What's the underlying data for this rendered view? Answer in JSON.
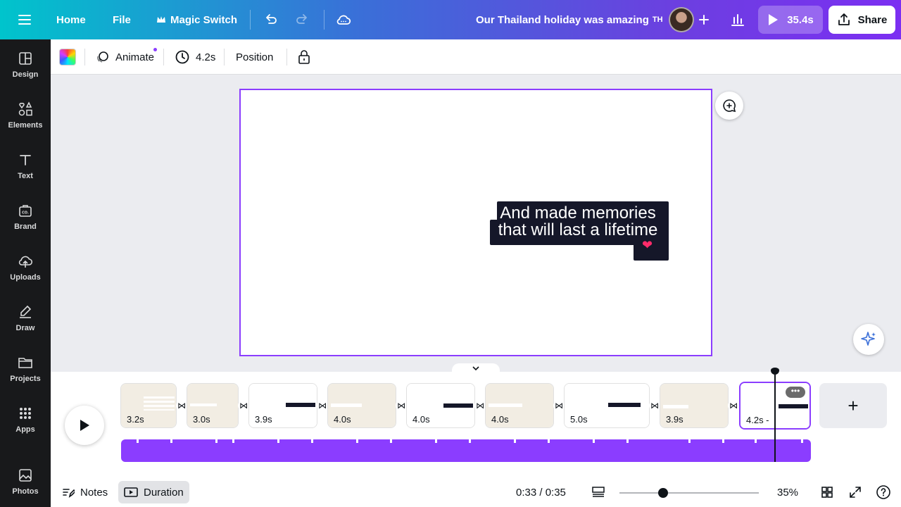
{
  "topbar": {
    "home_label": "Home",
    "file_label": "File",
    "magic_label": "Magic Switch",
    "doc_title": "Our Thailand holiday was amazing",
    "doc_title_flag": "TH",
    "play_label": "35.4s",
    "share_label": "Share"
  },
  "sidebar": {
    "items": [
      {
        "label": "Design",
        "icon": "design-icon"
      },
      {
        "label": "Elements",
        "icon": "elements-icon"
      },
      {
        "label": "Text",
        "icon": "text-icon"
      },
      {
        "label": "Brand",
        "icon": "brand-icon"
      },
      {
        "label": "Uploads",
        "icon": "uploads-icon"
      },
      {
        "label": "Draw",
        "icon": "draw-icon"
      },
      {
        "label": "Projects",
        "icon": "projects-icon"
      },
      {
        "label": "Apps",
        "icon": "apps-icon"
      },
      {
        "label": "Photos",
        "icon": "photos-icon"
      }
    ]
  },
  "context_toolbar": {
    "animate_label": "Animate",
    "duration_label": "4.2s",
    "position_label": "Position"
  },
  "canvas": {
    "caption_line1": "And made memories",
    "caption_line2": "that will last a lifetime",
    "heart_emoji": "❤"
  },
  "timeline": {
    "clips": [
      {
        "duration": "3.2s",
        "bg": "#f2ede3"
      },
      {
        "duration": "3.0s",
        "bg": "#f2ede3"
      },
      {
        "duration": "3.9s",
        "bg": "#ffffff"
      },
      {
        "duration": "4.0s",
        "bg": "#f2ede3"
      },
      {
        "duration": "4.0s",
        "bg": "#ffffff"
      },
      {
        "duration": "4.0s",
        "bg": "#f2ede3"
      },
      {
        "duration": "5.0s",
        "bg": "#ffffff"
      },
      {
        "duration": "3.9s",
        "bg": "#f2ede3"
      },
      {
        "duration": "4.2s -",
        "bg": "#ffffff"
      }
    ],
    "more_label": "•••",
    "add_label": "+"
  },
  "bottombar": {
    "notes_label": "Notes",
    "duration_label": "Duration",
    "time_readout": "0:33 / 0:35",
    "zoom_label": "35%"
  },
  "colors": {
    "accent": "#8b3dff",
    "caption_bg": "#151729"
  }
}
